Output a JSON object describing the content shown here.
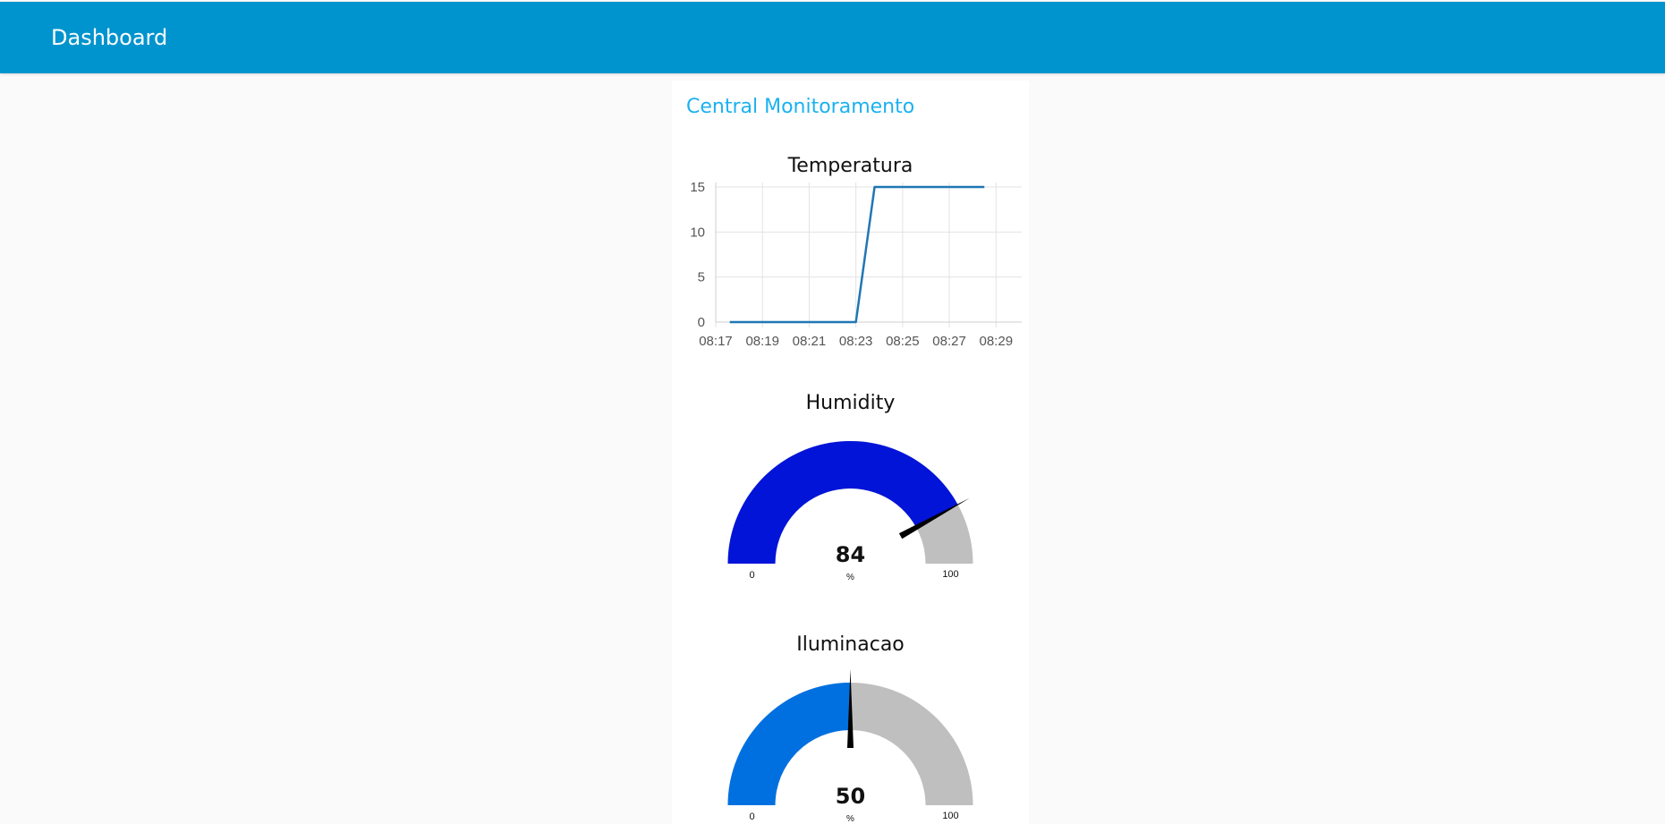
{
  "header": {
    "title": "Dashboard"
  },
  "group": {
    "title": "Central Monitoramento"
  },
  "temperature_chart": {
    "title": "Temperatura",
    "chart_data": {
      "type": "line",
      "title": "Temperatura",
      "xlabel": "",
      "ylabel": "",
      "x_ticks": [
        "08:17",
        "08:19",
        "08:21",
        "08:23",
        "08:25",
        "08:27",
        "08:29"
      ],
      "x_tick_minutes": [
        17,
        19,
        21,
        23,
        25,
        27,
        29
      ],
      "xlim": [
        17,
        30.1
      ],
      "y_ticks": [
        "0",
        "5",
        "10",
        "15"
      ],
      "ylim": [
        0,
        15.5
      ],
      "grid": true,
      "series": [
        {
          "color": "#1f77b4",
          "x": [
            17.6,
            23.0,
            23.8,
            28.5
          ],
          "y": [
            0,
            0,
            15,
            15
          ]
        }
      ]
    }
  },
  "humidity_gauge": {
    "title": "Humidity",
    "value": 84,
    "display_value": "84",
    "units": "%",
    "min": 0,
    "max": 100,
    "min_label": "0",
    "max_label": "100",
    "color": "#0214d8",
    "track_color": "#bfbfbf"
  },
  "light_gauge": {
    "title": "Iluminacao",
    "value": 50,
    "display_value": "50",
    "units": "%",
    "min": 0,
    "max": 100,
    "min_label": "0",
    "max_label": "100",
    "color": "#0070e0",
    "track_color": "#bfbfbf"
  }
}
